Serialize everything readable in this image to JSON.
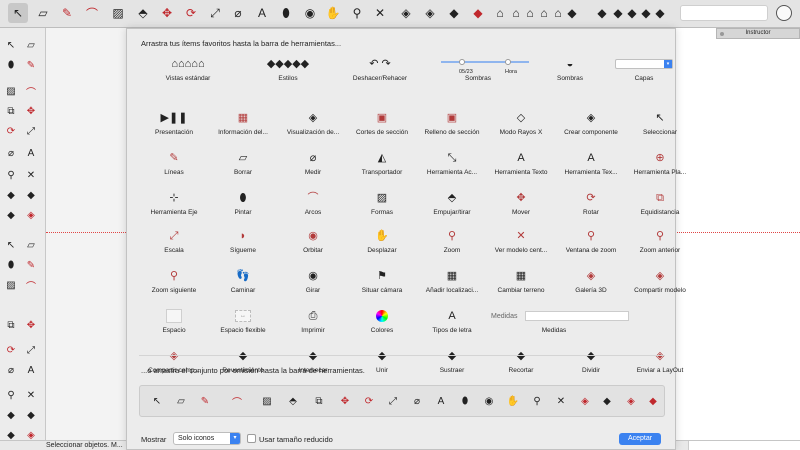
{
  "top_toolbar": {
    "icons": [
      "select-arrow-icon",
      "eraser-icon",
      "pencil-icon",
      "arc-icon",
      "shape-icon",
      "push-pull-icon",
      "move-icon",
      "rotate-icon",
      "scale-icon",
      "tape-icon",
      "text-icon",
      "paint-icon",
      "orbit-icon",
      "hand-icon",
      "zoom-icon",
      "zoom-extents-icon",
      "warehouse-icon",
      "share-icon",
      "extension-icon",
      "ruby-icon",
      "views-icon",
      "views-icon",
      "views-icon",
      "views-icon",
      "views-icon",
      "styles-icon",
      "styles-icon",
      "styles-icon",
      "styles-icon",
      "styles-icon",
      "styles-icon"
    ]
  },
  "instructor": {
    "title": "Instructor"
  },
  "status": {
    "text": "Seleccionar objetos. M..."
  },
  "dialog": {
    "instruction": "Arrastra tus ítems favoritos hasta la barra de herramientas...",
    "default_instruction": "...o arrastra el conjunto por omisión hasta la barra de herramientas.",
    "show_label": "Mostrar",
    "show_value": "Solo iconos",
    "reduced_label": "Usar tamaño reducido",
    "accept_label": "Aceptar",
    "shadow_month": "05/23",
    "shadow_time": "Hora",
    "items": [
      {
        "label": "Vistas estándar",
        "icon": "standard-views-icon",
        "glyph": "⌂⌂⌂⌂⌂"
      },
      {
        "label": "Estilos",
        "icon": "styles-icon",
        "glyph": "◆◆◆◆◆"
      },
      {
        "label": "Deshacer/Rehacer",
        "icon": "undo-redo-icon",
        "glyph": "↶ ↷"
      },
      {
        "label": "Sombras",
        "icon": "shadow-sliders-icon",
        "glyph": ""
      },
      {
        "label": "Sombras",
        "icon": "shadows-icon",
        "glyph": "◒"
      },
      {
        "label": "Capas",
        "icon": "layers-select-icon",
        "glyph": ""
      },
      {
        "label": "Presentación",
        "icon": "presentation-icon",
        "glyph": "▶❚❚"
      },
      {
        "label": "Información del...",
        "icon": "model-info-icon",
        "glyph": "▦"
      },
      {
        "label": "Visualización de...",
        "icon": "display-icon",
        "glyph": "◈"
      },
      {
        "label": "Cortes de sección",
        "icon": "section-cuts-icon",
        "glyph": "▣"
      },
      {
        "label": "Relleno de sección",
        "icon": "section-fill-icon",
        "glyph": "▣"
      },
      {
        "label": "Modo Rayos X",
        "icon": "xray-icon",
        "glyph": "◇"
      },
      {
        "label": "Crear componente",
        "icon": "create-component-icon",
        "glyph": "◈"
      },
      {
        "label": "Seleccionar",
        "icon": "select-icon",
        "glyph": "↖"
      },
      {
        "label": "Líneas",
        "icon": "pencil-icon",
        "glyph": "✎"
      },
      {
        "label": "Borrar",
        "icon": "eraser-icon",
        "glyph": "▱"
      },
      {
        "label": "Medir",
        "icon": "tape-measure-icon",
        "glyph": "⌀"
      },
      {
        "label": "Transportador",
        "icon": "protractor-icon",
        "glyph": "◭"
      },
      {
        "label": "Herramienta Ac...",
        "icon": "dimension-icon",
        "glyph": "⤡"
      },
      {
        "label": "Herramienta Texto",
        "icon": "text-icon",
        "glyph": "A"
      },
      {
        "label": "Herramienta Tex...",
        "icon": "3d-text-icon",
        "glyph": "A"
      },
      {
        "label": "Herramienta Pla...",
        "icon": "section-plane-icon",
        "glyph": "⊕"
      },
      {
        "label": "Herramienta Eje",
        "icon": "axes-icon",
        "glyph": "⊹"
      },
      {
        "label": "Pintar",
        "icon": "paint-bucket-icon",
        "glyph": "⬮"
      },
      {
        "label": "Arcos",
        "icon": "arc-icon",
        "glyph": "⌒"
      },
      {
        "label": "Formas",
        "icon": "shapes-icon",
        "glyph": "▨"
      },
      {
        "label": "Empujar/tirar",
        "icon": "push-pull-icon",
        "glyph": "⬘"
      },
      {
        "label": "Mover",
        "icon": "move-icon",
        "glyph": "✥"
      },
      {
        "label": "Rotar",
        "icon": "rotate-icon",
        "glyph": "⟳"
      },
      {
        "label": "Equidistancia",
        "icon": "offset-icon",
        "glyph": "⧉"
      },
      {
        "label": "Escala",
        "icon": "scale-icon",
        "glyph": "⤢"
      },
      {
        "label": "Sígueme",
        "icon": "follow-me-icon",
        "glyph": "◗"
      },
      {
        "label": "Orbitar",
        "icon": "orbit-icon",
        "glyph": "◉"
      },
      {
        "label": "Desplazar",
        "icon": "pan-icon",
        "glyph": "✋"
      },
      {
        "label": "Zoom",
        "icon": "zoom-icon",
        "glyph": "⚲"
      },
      {
        "label": "Ver modelo cent...",
        "icon": "zoom-extents-icon",
        "glyph": "✕"
      },
      {
        "label": "Ventana de zoom",
        "icon": "zoom-window-icon",
        "glyph": "⚲"
      },
      {
        "label": "Zoom anterior",
        "icon": "zoom-previous-icon",
        "glyph": "⚲"
      },
      {
        "label": "Zoom siguiente",
        "icon": "zoom-next-icon",
        "glyph": "⚲"
      },
      {
        "label": "Caminar",
        "icon": "walk-icon",
        "glyph": "👣"
      },
      {
        "label": "Girar",
        "icon": "look-around-icon",
        "glyph": "◉"
      },
      {
        "label": "Situar cámara",
        "icon": "position-camera-icon",
        "glyph": "⚑"
      },
      {
        "label": "Añadir localizaci...",
        "icon": "add-location-icon",
        "glyph": "▦"
      },
      {
        "label": "Cambiar terreno",
        "icon": "toggle-terrain-icon",
        "glyph": "▦"
      },
      {
        "label": "Galería 3D",
        "icon": "3d-warehouse-icon",
        "glyph": "◈"
      },
      {
        "label": "Compartir modelo",
        "icon": "share-model-icon",
        "glyph": "◈"
      },
      {
        "label": "Espacio",
        "icon": "space-icon",
        "glyph": ""
      },
      {
        "label": "Espacio flexible",
        "icon": "flexible-space-icon",
        "glyph": "↔"
      },
      {
        "label": "Imprimir",
        "icon": "print-icon",
        "glyph": "⎙"
      },
      {
        "label": "Colores",
        "icon": "colors-icon",
        "glyph": ""
      },
      {
        "label": "Tipos de letra",
        "icon": "fonts-icon",
        "glyph": "A"
      },
      {
        "label": "Medidas",
        "icon": "measurements-icon",
        "glyph": ""
      },
      {
        "label": "Compartir comp...",
        "icon": "share-component-icon",
        "glyph": "◈"
      },
      {
        "label": "Revestimiento",
        "icon": "outer-shell-icon",
        "glyph": "◆"
      },
      {
        "label": "Intersecar",
        "icon": "intersect-icon",
        "glyph": "◆"
      },
      {
        "label": "Unir",
        "icon": "union-icon",
        "glyph": "◆"
      },
      {
        "label": "Sustraer",
        "icon": "subtract-icon",
        "glyph": "◆"
      },
      {
        "label": "Recortar",
        "icon": "trim-icon",
        "glyph": "◆"
      },
      {
        "label": "Dividir",
        "icon": "split-icon",
        "glyph": "◆"
      },
      {
        "label": "Enviar a LayOut",
        "icon": "send-to-layout-icon",
        "glyph": "◈"
      }
    ],
    "measurements_label": "Medidas",
    "default_set_icons": [
      "select-arrow-icon",
      "eraser-icon",
      "pencil-icon",
      "arc-icon",
      "shape-icon",
      "push-pull-icon",
      "offset-icon",
      "move-icon",
      "rotate-icon",
      "scale-icon",
      "tape-icon",
      "text-icon",
      "paint-icon",
      "orbit-icon",
      "pan-icon",
      "zoom-icon",
      "zoom-extents-icon",
      "3d-warehouse-icon",
      "extension-icon",
      "send-to-layout-icon",
      "ruby-icon",
      "user-icon"
    ]
  },
  "colors": {
    "accent": "#3b82f0",
    "axis_red": "#e04545"
  }
}
